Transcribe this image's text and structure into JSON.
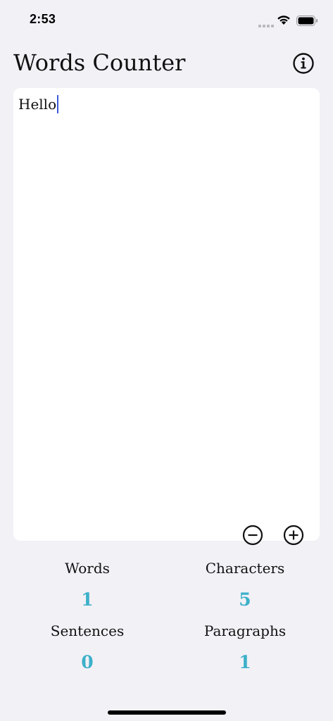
{
  "status_bar": {
    "time": "2:53"
  },
  "header": {
    "title": "Words Counter",
    "info_icon": "info-circle-icon"
  },
  "editor": {
    "text": "Hello",
    "zoom_out_icon": "minus-circle-icon",
    "zoom_in_icon": "plus-circle-icon"
  },
  "stats": {
    "words": {
      "label": "Words",
      "value": "1"
    },
    "characters": {
      "label": "Characters",
      "value": "5"
    },
    "sentences": {
      "label": "Sentences",
      "value": "0"
    },
    "paragraphs": {
      "label": "Paragraphs",
      "value": "1"
    }
  },
  "colors": {
    "background": "#f2f1f6",
    "card": "#ffffff",
    "accent": "#3cb0c9",
    "caret": "#3a5bd9"
  }
}
